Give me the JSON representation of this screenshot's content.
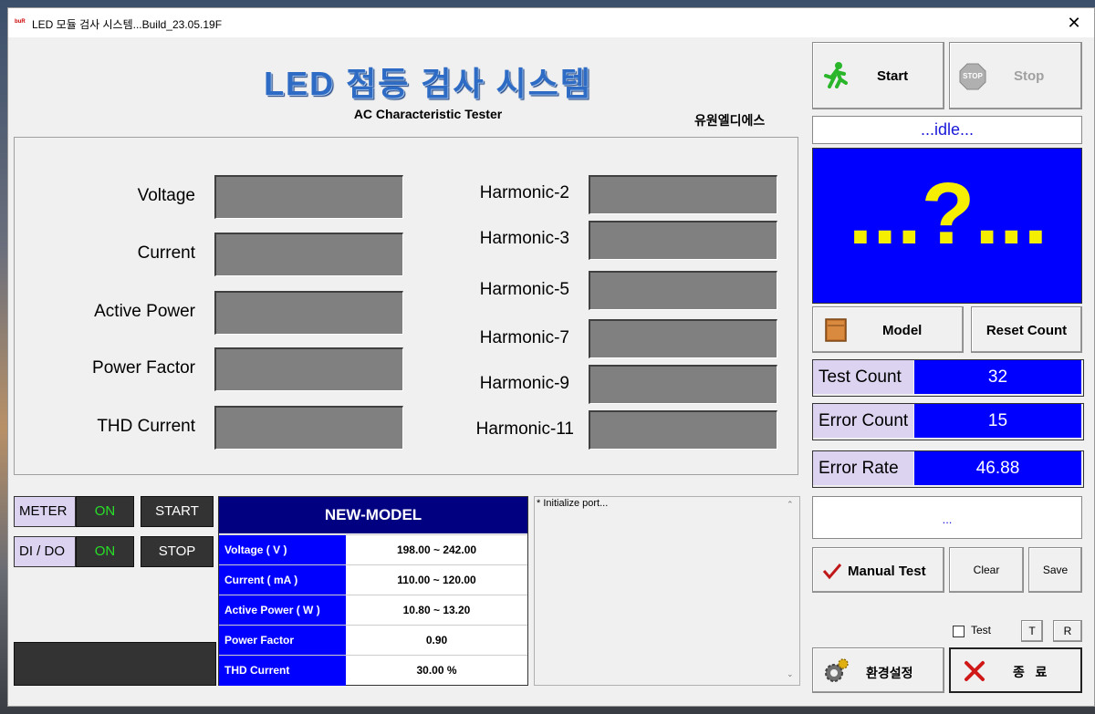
{
  "window": {
    "title": "LED 모듈 검사 시스템...Build_23.05.19F",
    "close_label": "✕"
  },
  "header": {
    "main_title": "LED 점등 검사 시스템",
    "subtitle": "AC Characteristic Tester",
    "company": "유원엘디에스"
  },
  "measurements": {
    "left": [
      "Voltage",
      "Current",
      "Active Power",
      "Power Factor",
      "THD Current"
    ],
    "right": [
      "Harmonic-2",
      "Harmonic-3",
      "Harmonic-5",
      "Harmonic-7",
      "Harmonic-9",
      "Harmonic-11"
    ]
  },
  "controls": {
    "start_label": "Start",
    "stop_label": "Stop",
    "stop_sign_text": "STOP",
    "status": "...idle...",
    "result_text": "...?...",
    "model_label": "Model",
    "reset_count_label": "Reset Count",
    "test_count_label": "Test Count",
    "test_count_value": "32",
    "error_count_label": "Error Count",
    "error_count_value": "15",
    "error_rate_label": "Error Rate",
    "error_rate_value": "46.88",
    "message": "...",
    "manual_test_label": "Manual Test",
    "clear_label": "Clear",
    "save_label": "Save",
    "test_checkbox_label": "Test",
    "t_label": "T",
    "r_label": "R",
    "settings_label": "환경설정",
    "exit_label": "종   료"
  },
  "io": {
    "meter_label": "METER",
    "meter_state": "ON",
    "dido_label": "DI / DO",
    "dido_state": "ON",
    "start_label": "START",
    "stop_label": "STOP"
  },
  "spec": {
    "model_name": "NEW-MODEL",
    "rows": [
      {
        "key": "Voltage ( V )",
        "value": "198.00 ~ 242.00"
      },
      {
        "key": "Current ( mA )",
        "value": "110.00 ~ 120.00"
      },
      {
        "key": "Active Power ( W )",
        "value": "10.80 ~ 13.20"
      },
      {
        "key": "Power Factor",
        "value": "0.90"
      },
      {
        "key": "THD Current",
        "value": "30.00 %"
      }
    ]
  },
  "log": {
    "first_line": "* Initialize port..."
  },
  "colors": {
    "accent_blue": "#0000ff",
    "header_navy": "#000080",
    "result_yellow": "#f6ee00",
    "on_green": "#28e028"
  }
}
